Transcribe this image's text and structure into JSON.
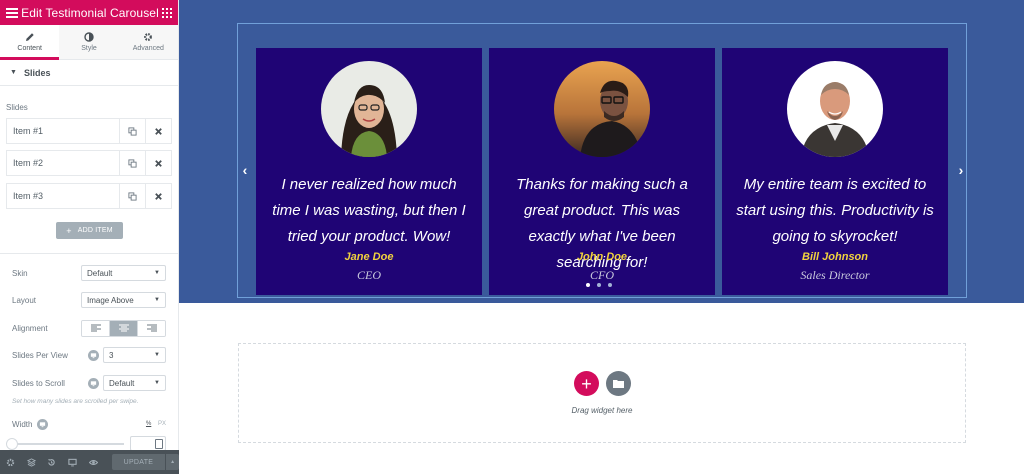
{
  "panel": {
    "header_title": "Edit Testimonial Carousel",
    "tabs": [
      {
        "label": "Content",
        "icon": "pencil-icon",
        "active": true
      },
      {
        "label": "Style",
        "icon": "contrast-icon",
        "active": false
      },
      {
        "label": "Advanced",
        "icon": "gear-icon",
        "active": false
      }
    ],
    "section_title": "Slides",
    "slides_label": "Slides",
    "items": [
      {
        "title": "Item #1"
      },
      {
        "title": "Item #2"
      },
      {
        "title": "Item #3"
      }
    ],
    "add_item_label": "ADD ITEM",
    "controls": {
      "skin": {
        "label": "Skin",
        "value": "Default"
      },
      "layout": {
        "label": "Layout",
        "value": "Image Above"
      },
      "alignment": {
        "label": "Alignment",
        "selected": "center"
      },
      "slides_per_view": {
        "label": "Slides Per View",
        "value": "3"
      },
      "slides_to_scroll": {
        "label": "Slides to Scroll",
        "value": "Default"
      },
      "hint": "Set how many slides are scrolled per swipe.",
      "width": {
        "label": "Width",
        "unit": "%",
        "unit_alt": "PX"
      }
    },
    "footer": {
      "update_label": "UPDATE"
    }
  },
  "preview": {
    "background": "#3a5a9b",
    "slide_bg": "#1f0475",
    "name_color": "#f1d33e",
    "slides": [
      {
        "quote": "I never realized how much time I was wasting, but then I tried your product. Wow!",
        "name": "Jane Doe",
        "title": "CEO"
      },
      {
        "quote": "Thanks for making such a great product. This was exactly what I've been searching for!",
        "name": "John Doe",
        "title": "CFO"
      },
      {
        "quote": "My entire team is excited to start using this. Productivity is going to skyrocket!",
        "name": "Bill Johnson",
        "title": "Sales Director"
      }
    ],
    "dropzone_text": "Drag widget here"
  },
  "colors": {
    "accent": "#d30c5c",
    "panel_footer": "#495157"
  }
}
